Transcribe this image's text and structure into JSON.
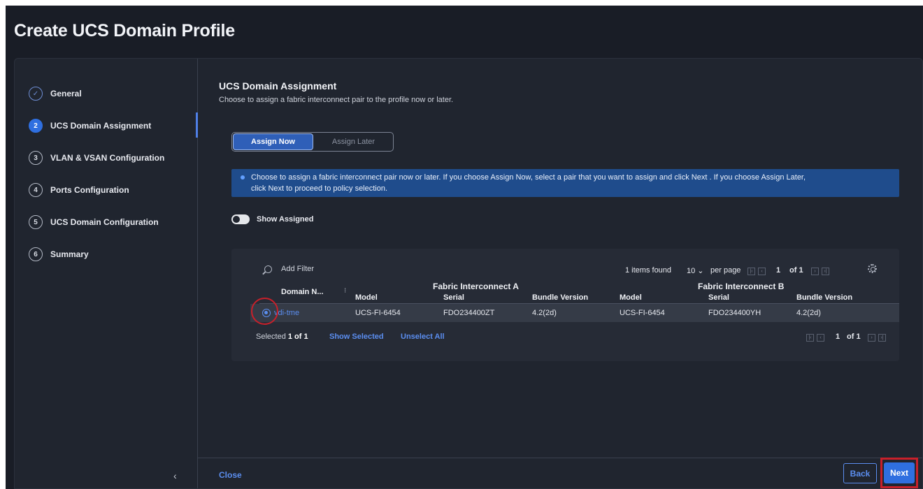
{
  "page": {
    "title": "Create UCS Domain Profile"
  },
  "sidebar": {
    "steps": [
      {
        "icon": "✓",
        "label": "General",
        "state": "done"
      },
      {
        "icon": "2",
        "label": "UCS Domain Assignment",
        "state": "active"
      },
      {
        "icon": "3",
        "label": "VLAN & VSAN Configuration",
        "state": "pending"
      },
      {
        "icon": "4",
        "label": "Ports Configuration",
        "state": "pending"
      },
      {
        "icon": "5",
        "label": "UCS Domain Configuration",
        "state": "pending"
      },
      {
        "icon": "6",
        "label": "Summary",
        "state": "pending"
      }
    ],
    "collapse_icon": "‹"
  },
  "main": {
    "title": "UCS Domain Assignment",
    "description": "Choose to assign a fabric interconnect pair to the profile now or later.",
    "toggle": {
      "assign_now": "Assign Now",
      "assign_later": "Assign Later",
      "selected": "assign_now"
    },
    "info_line1": "Choose to assign a fabric interconnect pair now or later. If you choose Assign Now, select a pair that you want to assign and click Next . If you choose Assign Later,",
    "info_line2": "click Next to proceed to policy selection.",
    "show_assigned": {
      "label": "Show Assigned",
      "on": false
    }
  },
  "table": {
    "filter_placeholder": "Add Filter",
    "items_found": "1 items found",
    "per_page_value": "10 ⌄",
    "per_page_label": "per page",
    "page_current": "1",
    "page_of": "of 1",
    "group_a": "Fabric Interconnect A",
    "group_b": "Fabric Interconnect B",
    "columns": {
      "domain_name": "Domain N...",
      "model_a": "Model",
      "serial_a": "Serial",
      "bundle_a": "Bundle Version",
      "model_b": "Model",
      "serial_b": "Serial",
      "bundle_b": "Bundle Version"
    },
    "rows": [
      {
        "domain_name": "vdi-tme",
        "model_a": "UCS-FI-6454",
        "serial_a": "FDO234400ZT",
        "bundle_a": "4.2(2d)",
        "model_b": "UCS-FI-6454",
        "serial_b": "FDO234400YH",
        "bundle_b": "4.2(2d)",
        "selected": true
      }
    ],
    "selected_prefix": "Selected",
    "selected_count": "1 of 1",
    "show_selected": "Show Selected",
    "unselect_all": "Unselect All",
    "bottom_page_current": "1",
    "bottom_page_of": "of 1"
  },
  "footer": {
    "close": "Close",
    "back": "Back",
    "next": "Next"
  },
  "colors": {
    "accent": "#2f6fe0",
    "link": "#5b8ef0",
    "highlight": "#c8202a",
    "banner": "#1f4c8c"
  }
}
